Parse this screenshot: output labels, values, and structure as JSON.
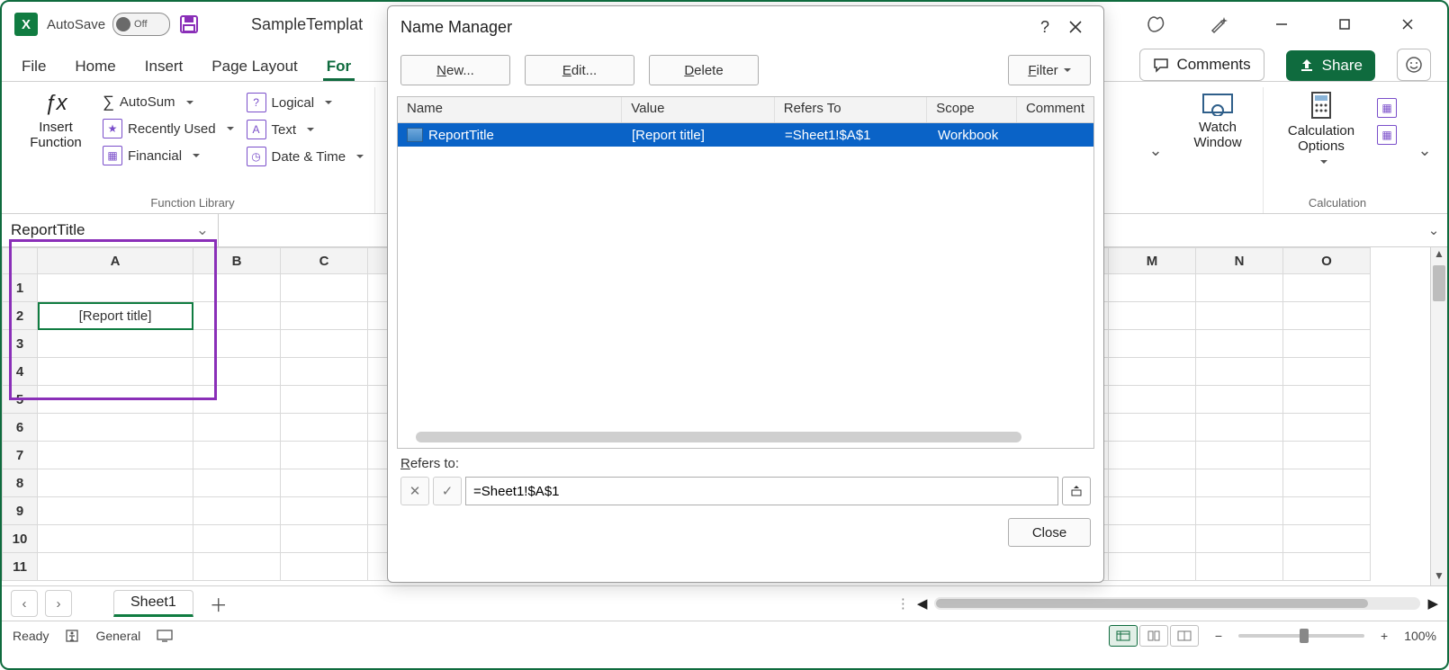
{
  "titlebar": {
    "autosave_label": "AutoSave",
    "autosave_state": "Off",
    "doc_name": "SampleTemplat"
  },
  "window_buttons": {
    "min": "–",
    "max": "□",
    "close": "✕"
  },
  "tabs": {
    "file": "File",
    "home": "Home",
    "insert": "Insert",
    "page_layout": "Page Layout",
    "formulas": "For",
    "active": "formulas"
  },
  "top_right": {
    "comments": "Comments",
    "share": "Share"
  },
  "ribbon": {
    "insert_function": "Insert Function",
    "autosum": "AutoSum",
    "recently_used": "Recently Used",
    "financial": "Financial",
    "logical": "Logical",
    "text": "Text",
    "date_time": "Date & Time",
    "func_lib_label": "Function Library",
    "watch_window": "Watch Window",
    "calc_options": "Calculation Options",
    "calc_label": "Calculation"
  },
  "namebox": "ReportTitle",
  "grid": {
    "cols": [
      "A",
      "B",
      "C",
      "M",
      "N",
      "O"
    ],
    "rows": [
      1,
      2,
      3,
      4,
      5,
      6,
      7,
      8,
      9,
      10,
      11
    ],
    "A2": "[Report title]"
  },
  "sheet_bar": {
    "sheet1": "Sheet1"
  },
  "status": {
    "ready": "Ready",
    "general": "General",
    "zoom": "100%"
  },
  "dialog": {
    "title": "Name Manager",
    "new_btn": "New...",
    "edit_btn": "Edit...",
    "delete_btn": "Delete",
    "filter_btn": "Filter",
    "cols": {
      "name": "Name",
      "value": "Value",
      "refers": "Refers To",
      "scope": "Scope",
      "comment": "Comment"
    },
    "row": {
      "name": "ReportTitle",
      "value": "[Report title]",
      "refers": "=Sheet1!$A$1",
      "scope": "Workbook",
      "comment": ""
    },
    "refers_label": "Refers to:",
    "refers_input": "=Sheet1!$A$1",
    "close": "Close"
  },
  "col_widths": {
    "name": 250,
    "value": 170,
    "refers": 170,
    "scope": 100,
    "comment": 80
  }
}
